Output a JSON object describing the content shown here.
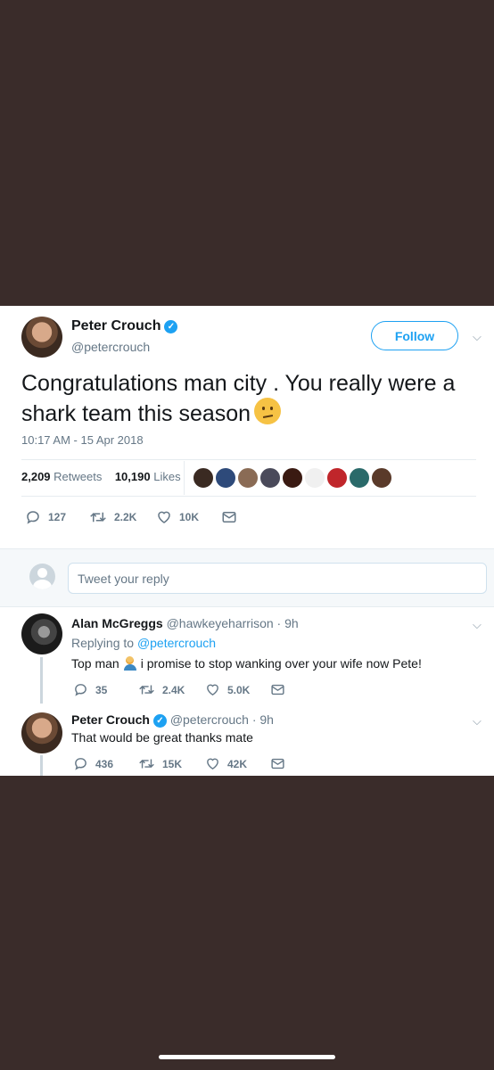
{
  "tweet": {
    "author_name": "Peter Crouch",
    "author_handle": "@petercrouch",
    "follow_label": "Follow",
    "text": "Congratulations man city . You really were a shark team this season",
    "timestamp": "10:17 AM - 15 Apr 2018",
    "retweets_count": "2,209",
    "retweets_label": "Retweets",
    "likes_count": "10,190",
    "likes_label": "Likes",
    "likers_colors": [
      "#3a2a22",
      "#2e4a7a",
      "#8a6b55",
      "#4a4a5a",
      "#3a1a12",
      "#f0f0f0",
      "#c0262b",
      "#2a6a6a",
      "#5a3a2a"
    ],
    "actions": {
      "replies": "127",
      "retweets": "2.2K",
      "likes": "10K"
    }
  },
  "reply_box": {
    "placeholder": "Tweet your reply"
  },
  "replies": [
    {
      "name": "Alan McGreggs",
      "handle": "@hawkeyeharrison · 9h",
      "replying_prefix": "Replying to",
      "replying_to": "@petercrouch",
      "text_before": "Top man",
      "text_after": "i promise to stop wanking over your wife now Pete!",
      "actions": {
        "replies": "35",
        "retweets": "2.4K",
        "likes": "5.0K"
      }
    },
    {
      "name": "Peter Crouch",
      "handle": "@petercrouch · 9h",
      "text": "That would be great thanks mate",
      "actions": {
        "replies": "436",
        "retweets": "15K",
        "likes": "42K"
      }
    }
  ],
  "colors": {
    "accent": "#1da1f2",
    "background": "#3a2c2a",
    "muted": "#657786"
  },
  "icons": [
    "verified-badge-icon",
    "chevron-down-icon",
    "reply-icon",
    "retweet-icon",
    "like-icon",
    "message-icon",
    "confused-face-emoji-icon",
    "raising-hand-emoji-icon"
  ]
}
